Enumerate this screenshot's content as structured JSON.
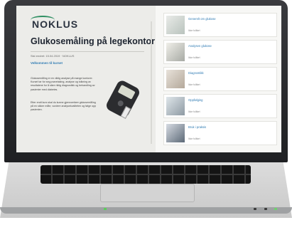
{
  "brand": {
    "logo": "NOKLUS"
  },
  "page": {
    "title": "Glukosemåling på legekontor",
    "meta": "Sist endret: 15.04.2019 · NOKLUS",
    "welcome": "Velkommen til kurset",
    "paragraph1": "Glukosemåling er en viktig analyse på mange kontorer. Kurset tar for seg prøvetaking, analyse og tolkning av resultatene for å sikre riktig diagnostikk og behandling av pasienter med diabetes.",
    "paragraph2": "Etter endt kurs skal du kunne gjennomføre glukosemåling på en sikker måte, vurdere analysekvaliteten og følge opp pasienten."
  },
  "modules": [
    {
      "title": "Generelt om glukose",
      "status": "Ikke fullført"
    },
    {
      "title": "Analysen glukose",
      "status": "Ikke fullført"
    },
    {
      "title": "Diagnostikk",
      "status": "Ikke fullført"
    },
    {
      "title": "Oppfølging",
      "status": "Ikke fullført"
    },
    {
      "title": "Bruk i praksis",
      "status": "Ikke fullført"
    }
  ]
}
